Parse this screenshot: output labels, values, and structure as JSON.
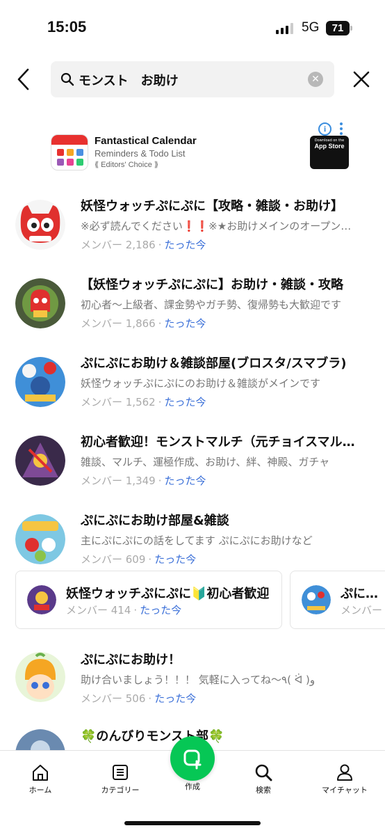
{
  "status_bar": {
    "time": "15:05",
    "network": "5G",
    "battery": "71"
  },
  "search": {
    "query": "モンスト　お助け"
  },
  "ad": {
    "title": "Fantastical Calendar",
    "subtitle": "Reminders & Todo List",
    "badge": "⟪ Editors' Choice ⟫",
    "store_small": "Download on the",
    "store_name": "App Store"
  },
  "results": [
    {
      "title": "妖怪ウォッチぷにぷに【攻略・雑談・お助け】",
      "desc": "※必ず読んでください❗️❗️※★お助けメインのオープンチャットです",
      "members": "メンバー 2,186",
      "when": "たった今"
    },
    {
      "title": "【妖怪ウォッチぷにぷに】お助け・雑談・攻略",
      "desc": "初心者〜上級者、課金勢やガチ勢、復帰勢も大歓迎です",
      "members": "メンバー 1,866",
      "when": "たった今"
    },
    {
      "title": "ぷにぷにお助け＆雑談部屋(ブロスタ/スマブラ)",
      "desc": "妖怪ウォッチぷにぷにのお助け＆雑談がメインです",
      "members": "メンバー 1,562",
      "when": "たった今"
    },
    {
      "title": "初心者歓迎！モンストマルチ（元チョイスマルチ）",
      "desc": "雑談、マルチ、運極作成、お助け、絆、神殿、ガチャ",
      "members": "メンバー 1,349",
      "when": "たった今"
    },
    {
      "title": "ぷにぷにお助け部屋&雑談",
      "desc": "主にぷにぷにの話をしてます ぷにぷにお助けなど",
      "members": "メンバー 609",
      "when": "たった今"
    }
  ],
  "carousel": [
    {
      "title": "妖怪ウォッチぷにぷに🔰初心者歓迎",
      "members": "メンバー 414",
      "when": "たった今"
    },
    {
      "title": "ぷにぷに",
      "members": "メンバー",
      "when": ""
    }
  ],
  "results_more": [
    {
      "title": "ぷにぷにお助け！",
      "desc": "助け合いましょう！！！ 気軽に入ってね〜٩( ᐛ )و",
      "members": "メンバー 506",
      "when": "たった今"
    },
    {
      "title": "🍀のんびりモンスト部🍀",
      "desc": "",
      "members": "",
      "when": ""
    }
  ],
  "nav": {
    "home": "ホーム",
    "category": "カテゴリー",
    "create": "作成",
    "search": "検索",
    "mychat": "マイチャット"
  },
  "colors": {
    "accent": "#06c755",
    "link": "#3a6fd8",
    "info": "#3a8dde"
  }
}
